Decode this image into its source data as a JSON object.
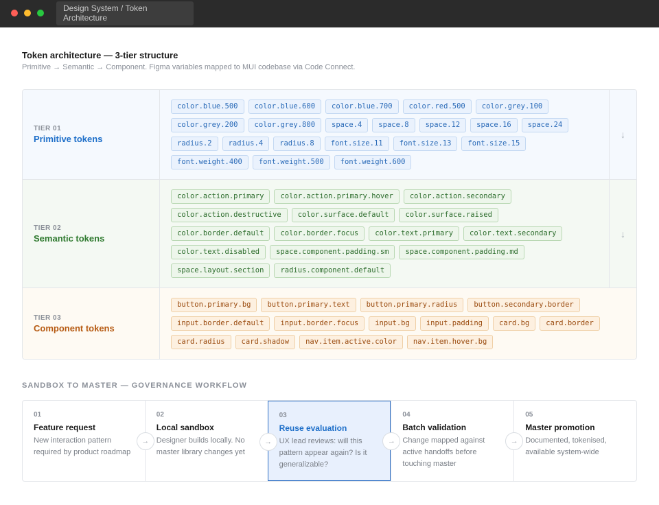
{
  "window": {
    "tab_title": "Design System / Token Architecture",
    "colors": {
      "close": "#ff5f57",
      "minimize": "#febc2e",
      "zoom": "#28c840"
    }
  },
  "header": {
    "title": "Token architecture — 3-tier structure",
    "subtitle": "Primitive → Semantic → Component. Figma variables mapped to MUI codebase via Code Connect."
  },
  "tiers": [
    {
      "num": "TIER 01",
      "name": "Primitive tokens",
      "arrow": "↓",
      "tokens": [
        "color.blue.500",
        "color.blue.600",
        "color.blue.700",
        "color.red.500",
        "color.grey.100",
        "color.grey.200",
        "color.grey.800",
        "space.4",
        "space.8",
        "space.12",
        "space.16",
        "space.24",
        "radius.2",
        "radius.4",
        "radius.8",
        "font.size.11",
        "font.size.13",
        "font.size.15",
        "font.weight.400",
        "font.weight.500",
        "font.weight.600"
      ]
    },
    {
      "num": "TIER 02",
      "name": "Semantic tokens",
      "arrow": "↓",
      "tokens": [
        "color.action.primary",
        "color.action.primary.hover",
        "color.action.secondary",
        "color.action.destructive",
        "color.surface.default",
        "color.surface.raised",
        "color.border.default",
        "color.border.focus",
        "color.text.primary",
        "color.text.secondary",
        "color.text.disabled",
        "space.component.padding.sm",
        "space.component.padding.md",
        "space.layout.section",
        "radius.component.default"
      ]
    },
    {
      "num": "TIER 03",
      "name": "Component tokens",
      "tokens": [
        "button.primary.bg",
        "button.primary.text",
        "button.primary.radius",
        "button.secondary.border",
        "input.border.default",
        "input.border.focus",
        "input.bg",
        "input.padding",
        "card.bg",
        "card.border",
        "card.radius",
        "card.shadow",
        "nav.item.active.color",
        "nav.item.hover.bg"
      ]
    }
  ],
  "governance": {
    "label": "SANDBOX TO MASTER — GOVERNANCE WORKFLOW",
    "arrow": "→",
    "steps": [
      {
        "num": "01",
        "title": "Feature request",
        "desc": "New interaction pattern required by product roadmap"
      },
      {
        "num": "02",
        "title": "Local sandbox",
        "desc": "Designer builds locally. No master library changes yet"
      },
      {
        "num": "03",
        "title": "Reuse evaluation",
        "desc": "UX lead reviews: will this pattern appear again? Is it generalizable?",
        "active": true
      },
      {
        "num": "04",
        "title": "Batch validation",
        "desc": "Change mapped against active handoffs before touching master"
      },
      {
        "num": "05",
        "title": "Master promotion",
        "desc": "Documented, tokenised, available system-wide"
      }
    ]
  }
}
